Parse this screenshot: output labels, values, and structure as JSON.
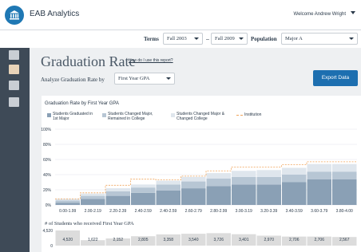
{
  "app": {
    "title": "EAB  Analytics",
    "welcome": "Welcome Andrew Wright"
  },
  "filters": {
    "terms_label": "Terms",
    "term_start": "Fall 2003",
    "term_end": "Fall 2009",
    "population_label": "Population",
    "population": "Major A"
  },
  "page": {
    "title": "Graduation Rate",
    "help_link": "How do I use this report?",
    "analyze_label": "Analyze Graduation Rate by",
    "analyze_value": "First Year GPA",
    "export_label": "Export Data"
  },
  "colors": {
    "accent": "#1d6fb0",
    "graduated_1st_major": "#8aa0b5",
    "changed_major_remained": "#b7c6d4",
    "changed_major_changed_college": "#dfe6ed",
    "institution_line": "#f0a45a",
    "count_bar": "#dcdcdc"
  },
  "chart_data": [
    {
      "type": "bar",
      "stacked": true,
      "title": "Graduation Rate by First Year GPA",
      "legend": [
        "Students Graduated in 1st Major",
        "Students Changed Major, Remained in College",
        "Students Changed Major & Changed College",
        "Institution"
      ],
      "legend_position": "top",
      "grid": true,
      "ylim": [
        0,
        100
      ],
      "y_ticks": [
        "100%",
        "80%",
        "60%",
        "40%",
        "20%",
        "0%"
      ],
      "categories": [
        "0.00-1.99",
        "2.00-2.19",
        "2.20-2.39",
        "2.40-2.59",
        "2.40-2.59",
        "2.60-2.79",
        "2.80-2.99",
        "3.00-3.19",
        "3.20-3.39",
        "3.40-3.59",
        "3.60-3.79",
        "3.80-4.00"
      ],
      "series": [
        {
          "name": "Students Graduated in 1st Major",
          "values": [
            3,
            8,
            12,
            16,
            19,
            22,
            25,
            27,
            27,
            30,
            34,
            34
          ]
        },
        {
          "name": "Students Changed Major, Remained in College",
          "values": [
            3,
            4,
            6,
            7,
            8,
            9,
            10,
            10,
            10,
            10,
            10,
            10
          ]
        },
        {
          "name": "Students Changed Major & Changed College",
          "values": [
            2,
            3,
            4,
            4,
            5,
            6,
            7,
            8,
            9,
            9,
            10,
            10
          ]
        },
        {
          "name": "Institution",
          "values": [
            8,
            16,
            26,
            34,
            33,
            38,
            45,
            50,
            50,
            53,
            57,
            57
          ]
        }
      ]
    },
    {
      "type": "bar",
      "title": "# of Students who received First Year GPA",
      "y_ticks": [
        "4,520",
        "0"
      ],
      "values": [
        4520,
        1622,
        2152,
        2805,
        3358,
        3540,
        3726,
        3401,
        2970,
        2706,
        2706,
        2567
      ],
      "value_labels": [
        "4,520",
        "1,622",
        "2,152",
        "2,805",
        "3,358",
        "3,540",
        "3,726",
        "3,401",
        "2,970",
        "2,706",
        "2,706",
        "2,567"
      ]
    }
  ]
}
